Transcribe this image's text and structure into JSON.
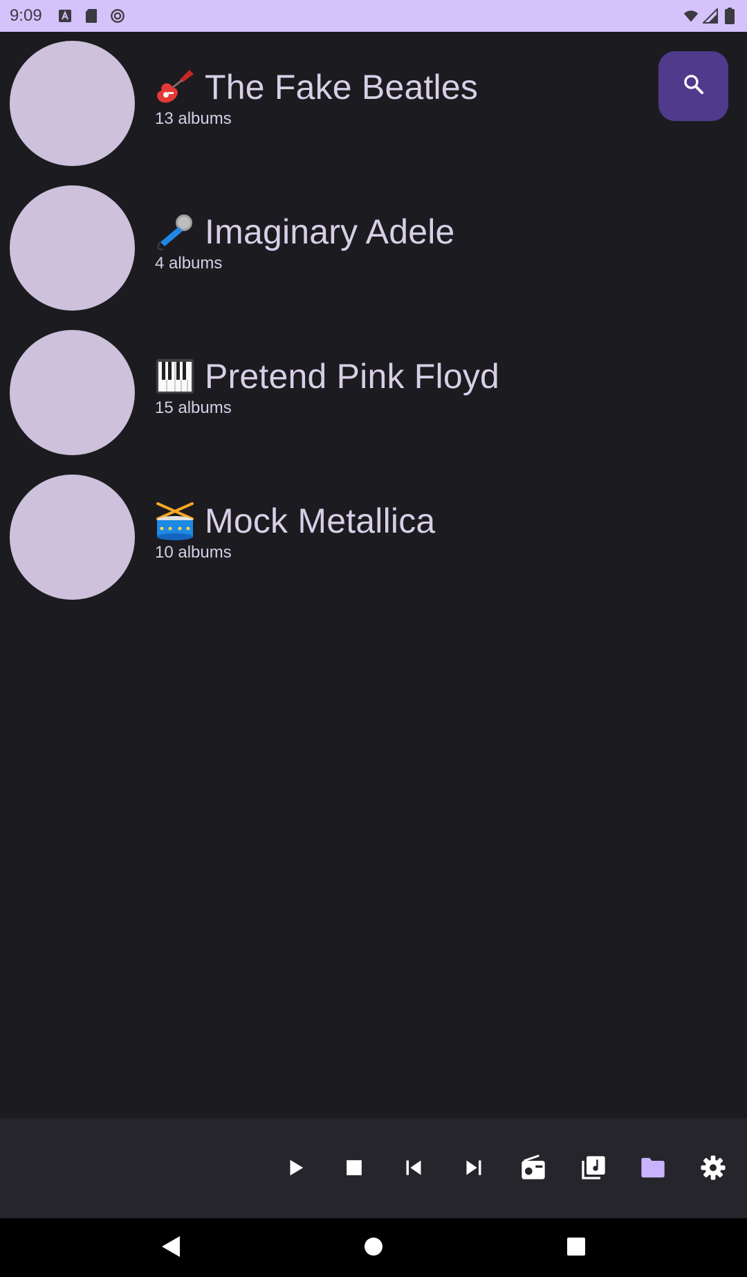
{
  "status_bar": {
    "time": "9:09",
    "icons": [
      "a-badge-icon",
      "sd-card-icon",
      "sync-icon",
      "wifi-icon",
      "signal-icon",
      "battery-icon"
    ]
  },
  "artists": [
    {
      "emoji": "guitar-icon",
      "name": "The Fake Beatles",
      "albums": "13 albums"
    },
    {
      "emoji": "microphone-icon",
      "name": "Imaginary Adele",
      "albums": "4 albums"
    },
    {
      "emoji": "piano-icon",
      "name": "Pretend Pink Floyd",
      "albums": "15 albums"
    },
    {
      "emoji": "drum-icon",
      "name": "Mock Metallica",
      "albums": "10 albums"
    }
  ],
  "search_button": {
    "icon": "search-icon"
  },
  "player_bar": {
    "buttons": [
      "play-icon",
      "stop-icon",
      "skip-previous-icon",
      "skip-next-icon",
      "radio-icon",
      "library-music-icon",
      "folder-icon",
      "settings-icon"
    ],
    "active": "folder-icon"
  },
  "colors": {
    "background": "#1c1b20",
    "status_bar": "#d4c2fa",
    "avatar": "#cdc1dc",
    "text": "#d7cfe6",
    "search_button": "#4f3a8c",
    "player_bar": "#26252c",
    "accent": "#c9b3ff"
  },
  "nav_bar": {
    "buttons": [
      "back-icon",
      "home-icon",
      "recents-icon"
    ]
  }
}
